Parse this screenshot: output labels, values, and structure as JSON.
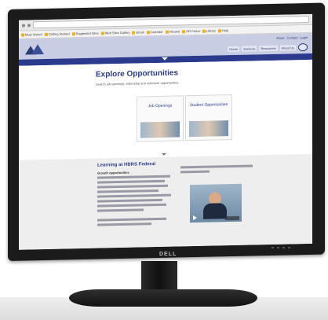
{
  "browser": {
    "bookmarks": [
      "Most Visited",
      "Getting Started",
      "Suggested Sites",
      "Web Slice Gallery",
      "Email",
      "Calendar",
      "Intranet",
      "HR Portal",
      "Library",
      "Help"
    ]
  },
  "site": {
    "utility_links": [
      "About",
      "Contact",
      "Login"
    ],
    "nav_links": [
      "Home",
      "Services",
      "Resources",
      "About Us"
    ]
  },
  "explore": {
    "title": "Explore Opportunities",
    "intro": "Search job openings, internship and volunteer opportunities.",
    "cards": [
      {
        "label": "Job Openings"
      },
      {
        "label": "Student Opportunities"
      }
    ]
  },
  "learning": {
    "heading": "Learning at HBRS Federal",
    "subheading": "Growth opportunities"
  },
  "brand": "DELL"
}
